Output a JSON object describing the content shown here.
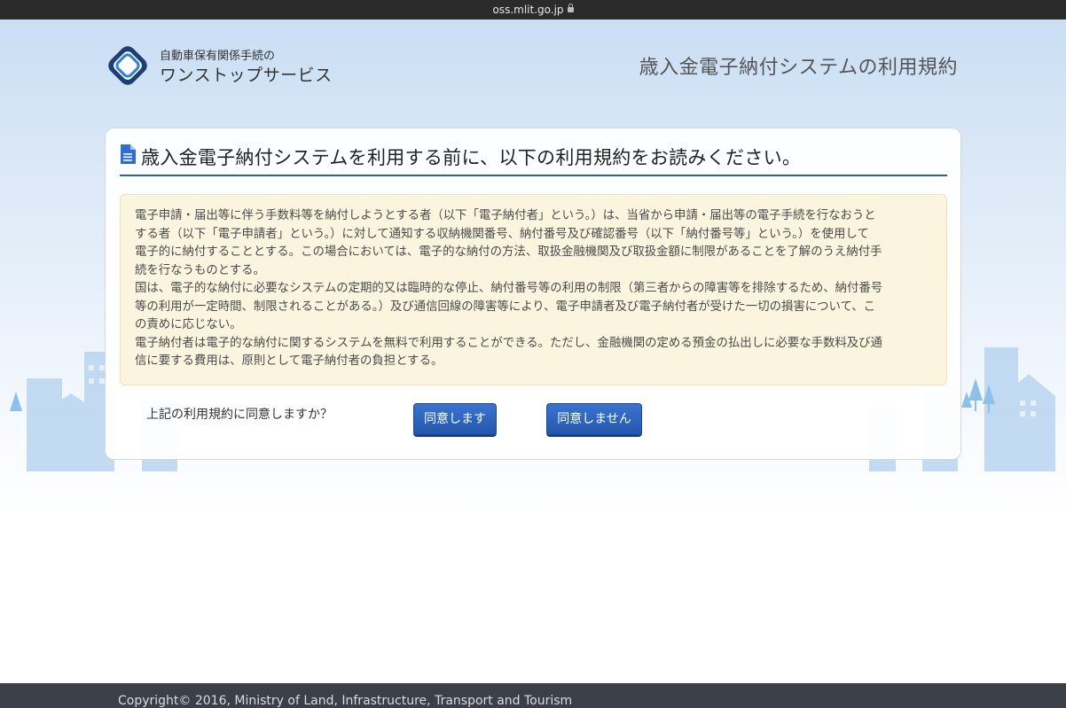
{
  "browser": {
    "url": "oss.mlit.go.jp"
  },
  "header": {
    "logo_line1": "自動車保有関係手続の",
    "logo_line2": "ワンストップサービス",
    "title": "歳入金電子納付システムの利用規約"
  },
  "panel": {
    "heading": "歳入金電子納付システムを利用する前に、以下の利用規約をお読みください。",
    "terms_lines": [
      "電子申請・届出等に伴う手数料等を納付しようとする者（以下「電子納付者」という。）は、当省から申請・届出等の電子手続を行なおうと",
      "する者（以下「電子申請者」という。）に対して通知する収納機関番号、納付番号及び確認番号（以下「納付番号等」という。）を使用して",
      "電子的に納付することとする。この場合においては、電子的な納付の方法、取扱金融機関及び取扱金額に制限があることを了解のうえ納付手",
      "続を行なうものとする。",
      "国は、電子的な納付に必要なシステムの定期的又は臨時的な停止、納付番号等の利用の制限（第三者からの障害等を排除するため、納付番号",
      "等の利用が一定時間、制限されることがある。）及び通信回線の障害等により、電子申請者及び電子納付者が受けた一切の損害について、こ",
      "の責めに応じない。",
      "電子納付者は電子的な納付に関するシステムを無料で利用することができる。ただし、金融機関の定める預金の払出しに必要な手数料及び通",
      "信に要する費用は、原則として電子納付者の負担とする。"
    ],
    "agree_question": "上記の利用規約に同意しますか？",
    "agree_button": "同意します",
    "disagree_button": "同意しません"
  },
  "footer": {
    "copyright": "Copyright© 2016, Ministry of Land, Infrastructure, Transport and Tourism"
  },
  "colors": {
    "accent": "#2d5fa8",
    "button": "#2457ad",
    "terms_bg": "#fbf5e0",
    "footer_bg": "#3a3f48"
  }
}
